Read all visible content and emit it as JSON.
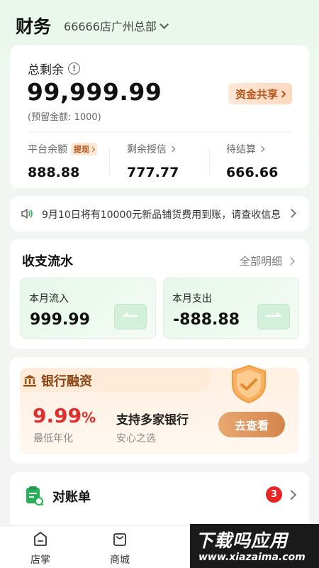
{
  "header": {
    "title": "财务",
    "store": "66666店广州总部"
  },
  "total": {
    "label": "总剩余",
    "amount": "99,999.99",
    "reserve": "(预留金额: 1000)",
    "share_label": "资金共享",
    "metrics": [
      {
        "label": "平台余额",
        "tag": "提现",
        "value": "888.88"
      },
      {
        "label": "剩余授信",
        "value": "777.77"
      },
      {
        "label": "待结算",
        "value": "666.66"
      }
    ]
  },
  "notice": {
    "text": "9月10日将有10000元新品铺货费用到账，请查收信息"
  },
  "flow": {
    "title": "收支流水",
    "all_label": "全部明细",
    "inflow": {
      "label": "本月流入",
      "value": "999.99"
    },
    "outflow": {
      "label": "本月支出",
      "value": "-888.88"
    }
  },
  "bank": {
    "title": "银行融资",
    "rate": "9.99",
    "rate_unit": "%",
    "rate_label": "最低年化",
    "support": "支持多家银行",
    "support_sub": "安心之选",
    "button": "去查看"
  },
  "reconcile": {
    "label": "对账单",
    "badge": "3"
  },
  "nav": {
    "items": [
      "店掌",
      "商城"
    ]
  },
  "watermark": {
    "big": "下载吗应用",
    "small": "www.xiazaima.com"
  },
  "colors": {
    "accent": "#d4854c",
    "brand_bg": "#e9f7ec",
    "alert": "#ea2424",
    "rate": "#e02d2d"
  }
}
